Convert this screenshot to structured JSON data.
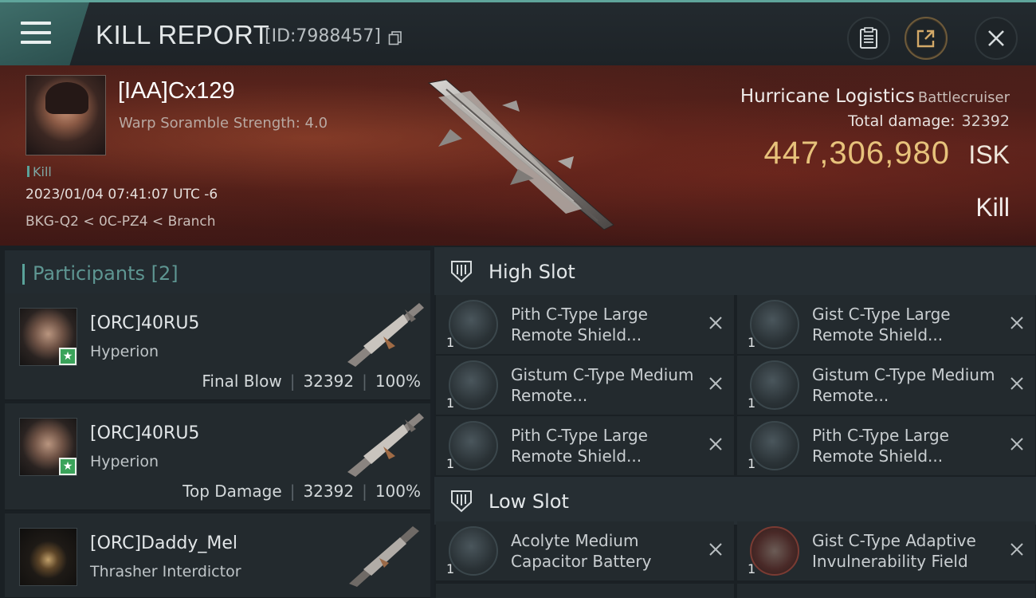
{
  "header": {
    "title": "KILL REPORT",
    "report_id": "[ID:7988457]"
  },
  "victim": {
    "name": "[IAA]Cx129",
    "warp_scramble": "Warp Soramble Strength: 4.0",
    "tag": "Kill",
    "datetime": "2023/01/04 07:41:07 UTC -6",
    "location": "BKG-Q2 < 0C-PZ4 < Branch",
    "ship_name": "Hurricane Logistics",
    "ship_class": "Battlecruiser",
    "total_damage_label": "Total damage:",
    "total_damage_value": "32392",
    "isk_value": "447,306,980",
    "isk_unit": "ISK",
    "result": "Kill"
  },
  "participants": {
    "label": "Participants [2]",
    "rows": [
      {
        "name": "[ORC]40RU5",
        "ship": "Hyperion",
        "role": "Final Blow",
        "damage": "32392",
        "percent": "100%"
      },
      {
        "name": "[ORC]40RU5",
        "ship": "Hyperion",
        "role": "Top Damage",
        "damage": "32392",
        "percent": "100%"
      },
      {
        "name": "[ORC]Daddy_Mel",
        "ship": "Thrasher Interdictor"
      }
    ]
  },
  "slots": {
    "high": {
      "label": "High Slot",
      "modules": [
        {
          "name": "Pith C-Type Large Remote Shield...",
          "qty": "1"
        },
        {
          "name": "Gist C-Type Large Remote Shield...",
          "qty": "1"
        },
        {
          "name": "Gistum C-Type Medium Remote...",
          "qty": "1"
        },
        {
          "name": "Gistum C-Type Medium Remote...",
          "qty": "1"
        },
        {
          "name": "Pith C-Type Large Remote Shield...",
          "qty": "1"
        },
        {
          "name": "Pith C-Type Large Remote Shield...",
          "qty": "1"
        }
      ]
    },
    "low": {
      "label": "Low Slot",
      "modules": [
        {
          "name": "Acolyte Medium Capacitor Battery",
          "qty": "1"
        },
        {
          "name": "Gist C-Type Adaptive Invulnerability Field",
          "qty": "1"
        }
      ]
    }
  },
  "colors": {
    "accent": "#5aa39a",
    "isk": "#e7c27b"
  }
}
